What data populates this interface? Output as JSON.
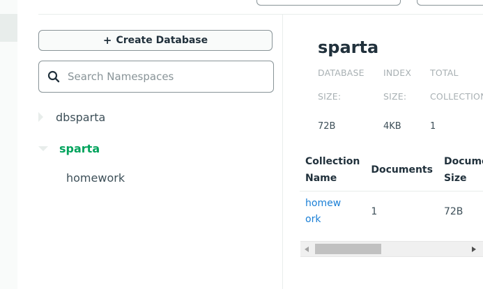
{
  "sidebar": {
    "create_button_label": "Create Database",
    "search_placeholder": "Search Namespaces",
    "databases": [
      {
        "name": "dbsparta",
        "expanded": false
      },
      {
        "name": "sparta",
        "expanded": true,
        "collections": [
          "homework"
        ]
      }
    ]
  },
  "detail": {
    "title": "sparta",
    "stats": [
      {
        "label_1": "DATABASE",
        "label_2": "SIZE:",
        "value": "72B"
      },
      {
        "label_1": "INDEX",
        "label_2": "SIZE:",
        "value": "4KB"
      },
      {
        "label_1": "TOTAL",
        "label_2": "COLLECTIONS:",
        "value": "1"
      }
    ],
    "table": {
      "headers": [
        {
          "line1": "Collection",
          "line2": "Name"
        },
        {
          "line1": "Documents",
          "line2": ""
        },
        {
          "line1": "Documents",
          "line2": "Size"
        }
      ],
      "rows": [
        {
          "name_1": "homew",
          "name_2": "ork",
          "documents": "1",
          "size": "72B"
        }
      ]
    }
  },
  "colors": {
    "accent_green": "#00a35c",
    "link_blue": "#1a7fd6",
    "border_gray": "#889397"
  },
  "icons": {
    "plus": "plus-icon",
    "search": "search-icon",
    "caret_right": "caret-right-icon",
    "caret_down": "caret-down-icon"
  }
}
